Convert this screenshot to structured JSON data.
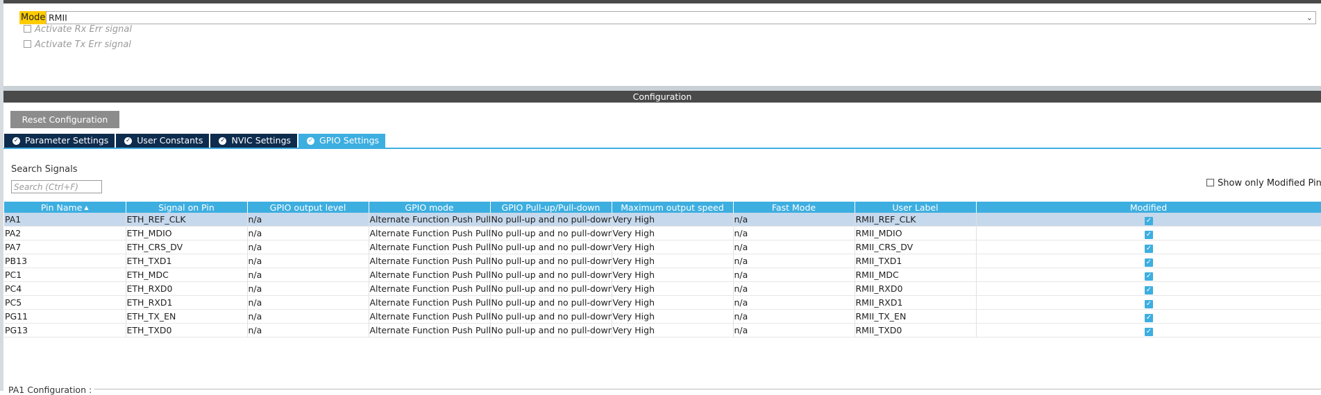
{
  "mode_section": {
    "mode_label": "Mode",
    "mode_value": "RMII",
    "checkboxes": [
      {
        "label": "Activate Rx Err signal",
        "checked": false
      },
      {
        "label": "Activate Tx Err signal",
        "checked": false
      }
    ]
  },
  "configuration": {
    "header": "Configuration",
    "reset_button": "Reset Configuration",
    "tabs": [
      {
        "label": "Parameter Settings",
        "active": false
      },
      {
        "label": "User Constants",
        "active": false
      },
      {
        "label": "NVIC Settings",
        "active": false
      },
      {
        "label": "GPIO Settings",
        "active": true
      }
    ],
    "search": {
      "label": "Search Signals",
      "placeholder": "Search (Ctrl+F)",
      "value": ""
    },
    "show_modified_label": "Show only Modified Pins",
    "table": {
      "columns": [
        "Pin Name",
        "Signal on Pin",
        "GPIO output level",
        "GPIO mode",
        "GPIO Pull-up/Pull-down",
        "Maximum output speed",
        "Fast Mode",
        "User Label",
        "Modified"
      ],
      "rows": [
        {
          "pin": "PA1",
          "signal": "ETH_REF_CLK",
          "output_level": "n/a",
          "mode": "Alternate Function Push Pull",
          "pull": "No pull-up and no pull-down",
          "speed": "Very High",
          "fast_mode": "n/a",
          "user_label": "RMII_REF_CLK",
          "modified": true
        },
        {
          "pin": "PA2",
          "signal": "ETH_MDIO",
          "output_level": "n/a",
          "mode": "Alternate Function Push Pull",
          "pull": "No pull-up and no pull-down",
          "speed": "Very High",
          "fast_mode": "n/a",
          "user_label": "RMII_MDIO",
          "modified": true
        },
        {
          "pin": "PA7",
          "signal": "ETH_CRS_DV",
          "output_level": "n/a",
          "mode": "Alternate Function Push Pull",
          "pull": "No pull-up and no pull-down",
          "speed": "Very High",
          "fast_mode": "n/a",
          "user_label": "RMII_CRS_DV",
          "modified": true
        },
        {
          "pin": "PB13",
          "signal": "ETH_TXD1",
          "output_level": "n/a",
          "mode": "Alternate Function Push Pull",
          "pull": "No pull-up and no pull-down",
          "speed": "Very High",
          "fast_mode": "n/a",
          "user_label": "RMII_TXD1",
          "modified": true
        },
        {
          "pin": "PC1",
          "signal": "ETH_MDC",
          "output_level": "n/a",
          "mode": "Alternate Function Push Pull",
          "pull": "No pull-up and no pull-down",
          "speed": "Very High",
          "fast_mode": "n/a",
          "user_label": "RMII_MDC",
          "modified": true
        },
        {
          "pin": "PC4",
          "signal": "ETH_RXD0",
          "output_level": "n/a",
          "mode": "Alternate Function Push Pull",
          "pull": "No pull-up and no pull-down",
          "speed": "Very High",
          "fast_mode": "n/a",
          "user_label": "RMII_RXD0",
          "modified": true
        },
        {
          "pin": "PC5",
          "signal": "ETH_RXD1",
          "output_level": "n/a",
          "mode": "Alternate Function Push Pull",
          "pull": "No pull-up and no pull-down",
          "speed": "Very High",
          "fast_mode": "n/a",
          "user_label": "RMII_RXD1",
          "modified": true
        },
        {
          "pin": "PG11",
          "signal": "ETH_TX_EN",
          "output_level": "n/a",
          "mode": "Alternate Function Push Pull",
          "pull": "No pull-up and no pull-down",
          "speed": "Very High",
          "fast_mode": "n/a",
          "user_label": "RMII_TX_EN",
          "modified": true
        },
        {
          "pin": "PG13",
          "signal": "ETH_TXD0",
          "output_level": "n/a",
          "mode": "Alternate Function Push Pull",
          "pull": "No pull-up and no pull-down",
          "speed": "Very High",
          "fast_mode": "n/a",
          "user_label": "RMII_TXD0",
          "modified": true
        }
      ]
    },
    "pin_config_label": "PA1 Configuration :"
  },
  "colors": {
    "header_bar": "#4a4a4a",
    "accent": "#3daee0",
    "tab_inactive": "#0e2c4e",
    "mode_highlight": "#ffcc00",
    "selected_row": "#c6d8ec"
  },
  "icons": {
    "tab_check": "check-circle-icon",
    "select_arrow": "chevron-down-icon",
    "sort": "sort-ascending-icon",
    "modified": "checked-checkbox-icon"
  }
}
